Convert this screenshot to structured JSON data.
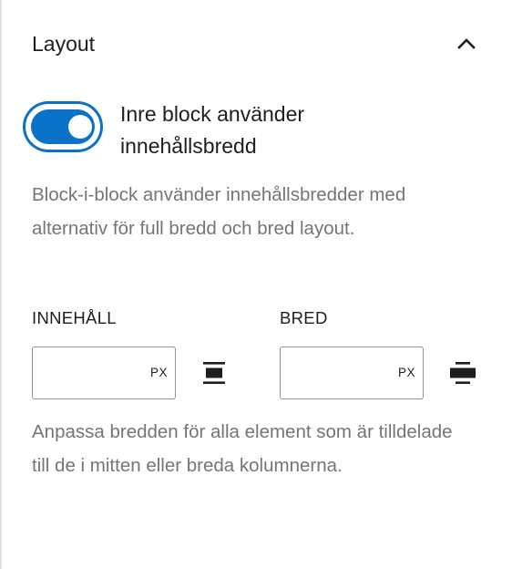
{
  "panel": {
    "title": "Layout",
    "collapse_icon": "chevron-up-icon"
  },
  "toggle": {
    "label": "Inre block använder innehållsbredd",
    "checked": true,
    "color": "#0a72c9"
  },
  "help_top": "Block-i-block använder innehållsbredder med alternativ för full bredd och bred layout.",
  "content_width": {
    "label": "INNEHÅLL",
    "value": "",
    "unit": "PX",
    "icon": "align-center-icon"
  },
  "wide_width": {
    "label": "BRED",
    "value": "",
    "unit": "PX",
    "icon": "align-wide-icon"
  },
  "help_bottom": "Anpassa bredden för alla element som är tilldelade till de i mitten eller breda kolumnerna."
}
